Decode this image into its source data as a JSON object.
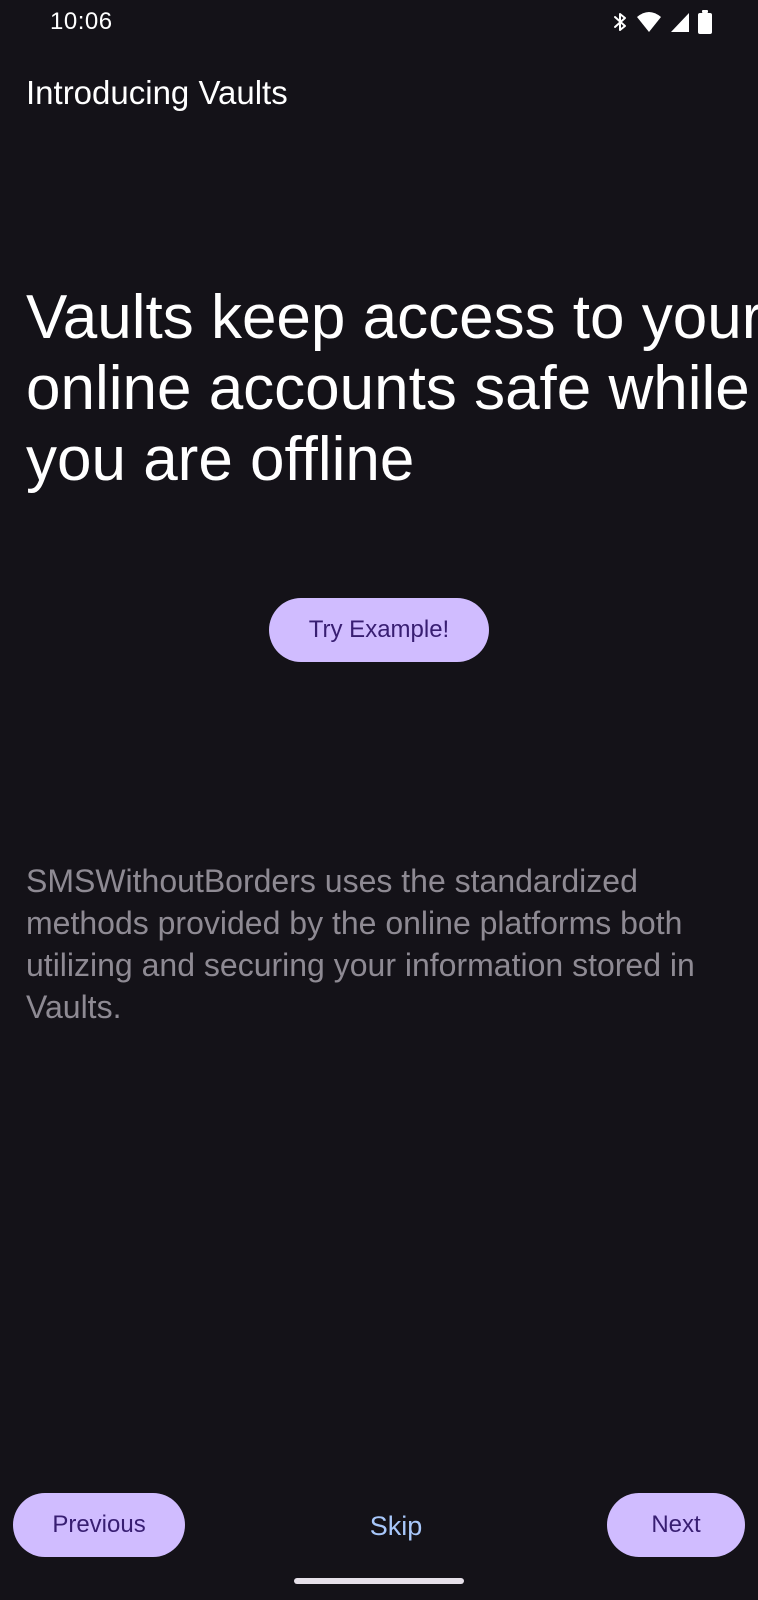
{
  "status_bar": {
    "time": "10:06",
    "icons": [
      "bluetooth-icon",
      "wifi-icon",
      "signal-icon",
      "battery-icon"
    ]
  },
  "screen": {
    "title": "Introducing Vaults",
    "headline": "Vaults keep access to your online accounts safe while you are offline",
    "try_button_label": "Try Example!",
    "description": "SMSWithoutBorders uses the standardized methods provided by the online platforms both utilizing and securing your information stored in Vaults."
  },
  "navigation": {
    "previous_label": "Previous",
    "skip_label": "Skip",
    "next_label": "Next"
  },
  "colors": {
    "background": "#141218",
    "accent_button": "#D0BCFF",
    "button_text": "#381E72",
    "skip_text": "#A8C7FA",
    "description_text": "#8E8A93"
  }
}
